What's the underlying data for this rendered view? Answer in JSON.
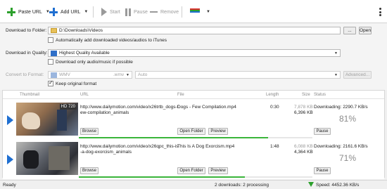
{
  "toolbar": {
    "paste_url": "Paste URL",
    "add_url": "Add URL",
    "start": "Start",
    "pause": "Pause",
    "remove": "Remove"
  },
  "settings": {
    "download_to_label": "Download to Folder:",
    "folder_path": "D:\\Downloads\\Videos",
    "browse_btn": "...",
    "open_btn": "Open",
    "auto_itunes": "Automatically add downloaded videos/audios to iTunes",
    "quality_label": "Download in Quality:",
    "quality_value": "Highest Quality Available",
    "only_audio": "Download only audio/music if possible",
    "convert_label": "Convert to Format:",
    "format_value": "WMV",
    "format_ext": ".wmv",
    "auto_value": "Auto",
    "advanced_btn": "Advanced...",
    "keep_original": "Keep original format"
  },
  "columns": {
    "thumbnail": "Thumbnail",
    "url": "URL",
    "file": "File",
    "length": "Length",
    "size": "Size",
    "status": "Status"
  },
  "downloads": [
    {
      "hd_badge": "HD 720",
      "url_line1": "http://www.dailymotion.com/video/x26trtb_dogs-f",
      "url_line2": "ew-compilation_animals",
      "file": "Dogs - Few Compilation.mp4",
      "length": "0:30",
      "size_total": "7,878 KB",
      "size_done": "6,396 KB",
      "status": "Downloading: 2290.7 KB/s",
      "percent": "81%",
      "progress": 0.81,
      "browse": "Browse",
      "open_folder": "Open Folder",
      "preview": "Preview",
      "pause": "Pause"
    },
    {
      "hd_badge": "",
      "url_line1": "http://www.dailymotion.com/video/x26qpc_this-is",
      "url_line2": "-a-dog-exorcism_animals",
      "file": "This Is A Dog Exorcism.mp4",
      "length": "1:48",
      "size_total": "6,088 KB",
      "size_done": "4,364 KB",
      "status": "Downloading: 2161.6 KB/s",
      "percent": "71%",
      "progress": 0.71,
      "browse": "Browse",
      "open_folder": "Open Folder",
      "preview": "Preview",
      "pause": "Pause"
    }
  ],
  "statusbar": {
    "ready": "Ready",
    "summary": "2 downloads: 2 processing",
    "speed": "Speed: 4452.36 KB/s"
  },
  "colors": {
    "accent": "#1f6fd1",
    "progress": "#3ab53a",
    "add_green": "#2ca02c"
  }
}
